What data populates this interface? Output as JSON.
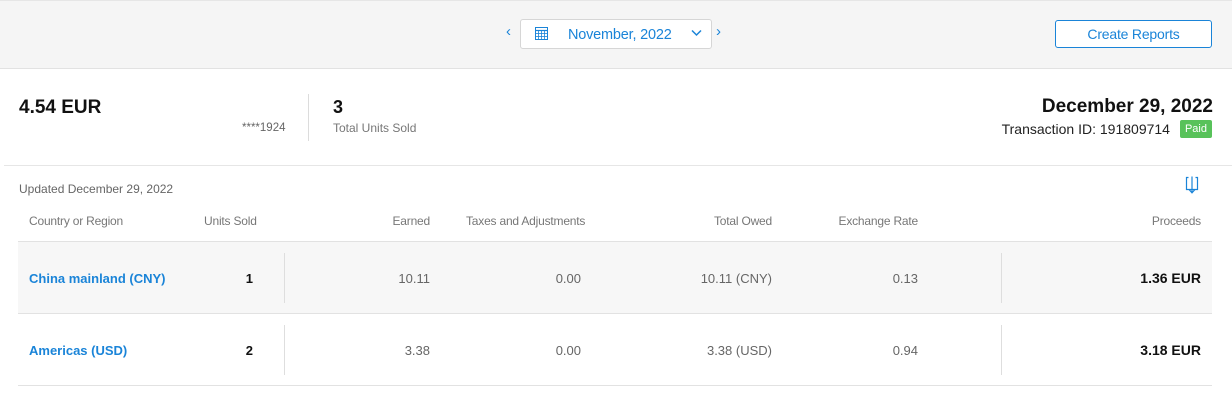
{
  "header": {
    "prev_icon": "chevron-left",
    "next_icon": "chevron-right",
    "calendar_icon": "calendar-grid",
    "month": "November, 2022",
    "dropdown_icon": "chevron-down",
    "create_reports_label": "Create Reports"
  },
  "summary": {
    "amount": "4.54 EUR",
    "account": "****1924",
    "units_value": "3",
    "units_label": "Total Units Sold",
    "date": "December 29, 2022",
    "transaction": "Transaction ID: 191809714",
    "status": "Paid"
  },
  "table": {
    "updated": "Updated December 29, 2022",
    "download_icon": "download",
    "headers": {
      "country": "Country or Region",
      "units": "Units Sold",
      "earned": "Earned",
      "taxes": "Taxes and Adjustments",
      "owed": "Total Owed",
      "rate": "Exchange Rate",
      "proceeds": "Proceeds"
    },
    "rows": [
      {
        "country": "China mainland (CNY)",
        "units": "1",
        "earned": "10.11",
        "taxes": "0.00",
        "owed": "10.11 (CNY)",
        "rate": "0.13",
        "proceeds": "1.36 EUR"
      },
      {
        "country": "Americas (USD)",
        "units": "2",
        "earned": "3.38",
        "taxes": "0.00",
        "owed": "3.38 (USD)",
        "rate": "0.94",
        "proceeds": "3.18 EUR"
      }
    ]
  },
  "colors": {
    "accent": "#1a84d8",
    "paid": "#58c25a",
    "header_bg": "#f5f5f5"
  }
}
